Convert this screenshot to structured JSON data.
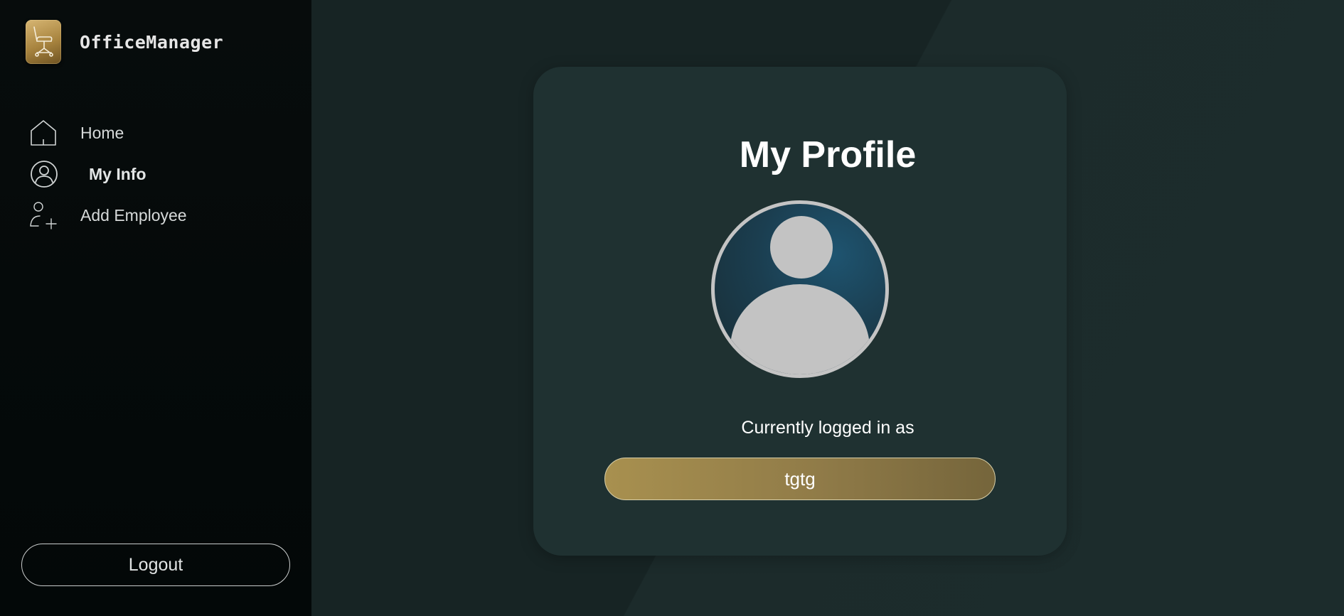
{
  "brand": {
    "name": "OfficeManager",
    "logo_icon": "office-chair-icon",
    "logo_color": "#c8a35c"
  },
  "sidebar": {
    "items": [
      {
        "label": "Home",
        "icon": "home-icon",
        "active": false
      },
      {
        "label": "My Info",
        "icon": "user-circle-icon",
        "active": true
      },
      {
        "label": "Add Employee",
        "icon": "user-plus-icon",
        "active": false
      }
    ],
    "logout_label": "Logout"
  },
  "profile": {
    "title": "My Profile",
    "avatar_icon": "default-avatar-icon",
    "logged_in_label": "Currently logged in as",
    "username": "tgtg",
    "accent_color": "#a8904f"
  }
}
